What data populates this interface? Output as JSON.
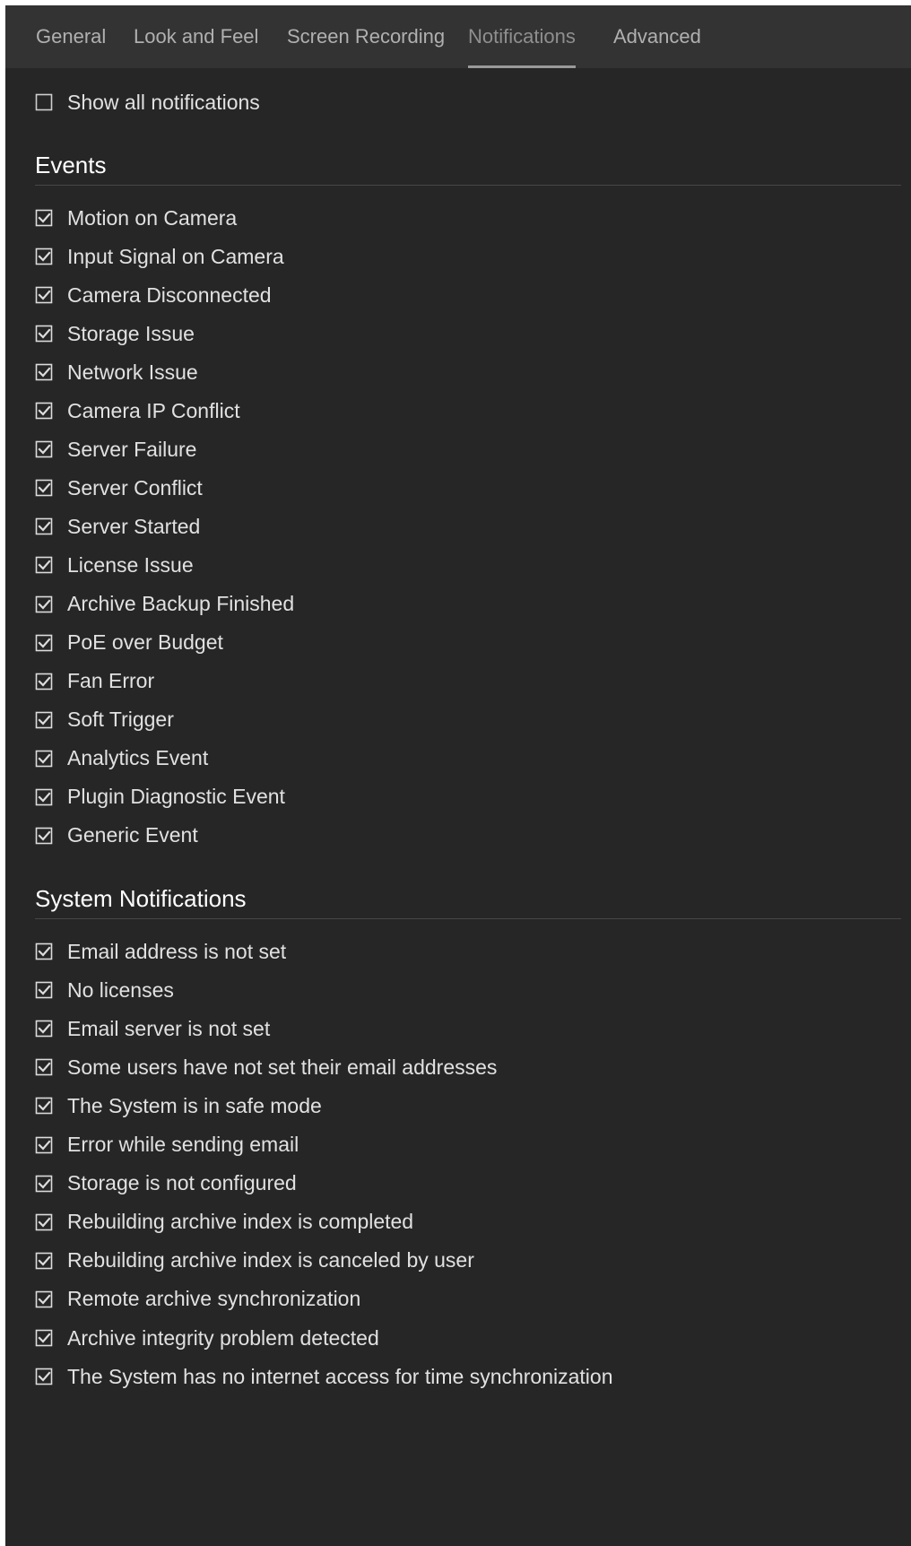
{
  "tabs": [
    {
      "label": "General"
    },
    {
      "label": "Look and Feel"
    },
    {
      "label": "Screen Recording"
    },
    {
      "label": "Notifications",
      "active": true
    },
    {
      "label": "Advanced"
    }
  ],
  "show_all": {
    "label": "Show all notifications",
    "checked": false
  },
  "events": {
    "title": "Events",
    "items": [
      {
        "label": "Motion on Camera",
        "checked": true
      },
      {
        "label": "Input Signal on Camera",
        "checked": true
      },
      {
        "label": "Camera Disconnected",
        "checked": true
      },
      {
        "label": "Storage Issue",
        "checked": true
      },
      {
        "label": "Network Issue",
        "checked": true
      },
      {
        "label": "Camera IP Conflict",
        "checked": true
      },
      {
        "label": "Server Failure",
        "checked": true
      },
      {
        "label": "Server Conflict",
        "checked": true
      },
      {
        "label": "Server Started",
        "checked": true
      },
      {
        "label": "License Issue",
        "checked": true
      },
      {
        "label": "Archive Backup Finished",
        "checked": true
      },
      {
        "label": "PoE over Budget",
        "checked": true
      },
      {
        "label": "Fan Error",
        "checked": true
      },
      {
        "label": "Soft Trigger",
        "checked": true
      },
      {
        "label": "Analytics Event",
        "checked": true
      },
      {
        "label": "Plugin Diagnostic Event",
        "checked": true
      },
      {
        "label": "Generic Event",
        "checked": true
      }
    ]
  },
  "system_notifications": {
    "title": "System Notifications",
    "items": [
      {
        "label": "Email address is not set",
        "checked": true
      },
      {
        "label": "No licenses",
        "checked": true
      },
      {
        "label": "Email server is not set",
        "checked": true
      },
      {
        "label": "Some users have not set their email addresses",
        "checked": true
      },
      {
        "label": "The System is in safe mode",
        "checked": true
      },
      {
        "label": "Error while sending email",
        "checked": true
      },
      {
        "label": "Storage is not configured",
        "checked": true
      },
      {
        "label": "Rebuilding archive index is completed",
        "checked": true
      },
      {
        "label": "Rebuilding archive index is canceled by user",
        "checked": true
      },
      {
        "label": "Remote archive synchronization",
        "checked": true
      },
      {
        "label": "Archive integrity problem detected",
        "checked": true
      },
      {
        "label": "The System has no internet access for time synchronization",
        "checked": true
      }
    ]
  },
  "colors": {
    "background": "#262626",
    "tabbar": "#333333",
    "text": "#e1e1e1",
    "checkbox": "#dcdcdc"
  }
}
